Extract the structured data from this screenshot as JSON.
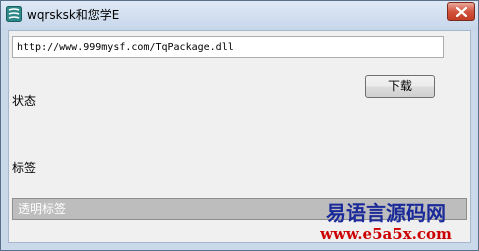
{
  "window": {
    "title": "wqrsksk和您学E",
    "close_label": "×"
  },
  "form": {
    "url_value": "http://www.999mysf.com/TqPackage.dll",
    "download_label": "下载",
    "status_label": "状态",
    "tag_label": "标签",
    "transparent_label": "透明标签"
  },
  "watermark": {
    "line1": "易语言源码网",
    "line2": "www.e5a5x.com"
  },
  "icons": {
    "app": "app-logo-icon",
    "close": "close-icon"
  },
  "colors": {
    "titlebar": "#c6d6ea",
    "client_bg": "#f0f0f0",
    "close_button": "#c23d24",
    "watermark_blue": "#1b2a9a",
    "watermark_red": "#cc0000"
  }
}
